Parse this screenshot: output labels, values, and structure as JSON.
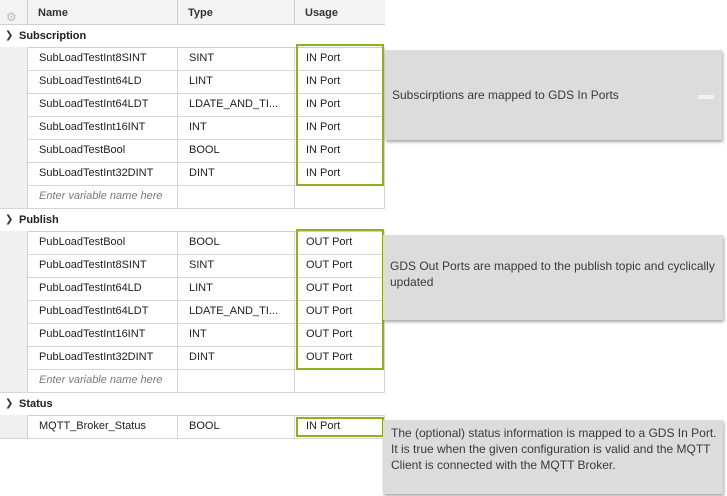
{
  "columns": {
    "name": "Name",
    "type": "Type",
    "usage": "Usage"
  },
  "groups": {
    "subscription": {
      "label": "Subscription",
      "rows": [
        {
          "name": "SubLoadTestInt8SINT",
          "type": "SINT",
          "usage": "IN Port"
        },
        {
          "name": "SubLoadTestInt64LD",
          "type": "LINT",
          "usage": "IN Port"
        },
        {
          "name": "SubLoadTestInt64LDT",
          "type": "LDATE_AND_TI...",
          "usage": "IN Port"
        },
        {
          "name": "SubLoadTestInt16INT",
          "type": "INT",
          "usage": "IN Port"
        },
        {
          "name": "SubLoadTestBool",
          "type": "BOOL",
          "usage": "IN Port"
        },
        {
          "name": "SubLoadTestInt32DINT",
          "type": "DINT",
          "usage": "IN Port"
        }
      ],
      "placeholder": "Enter variable name here"
    },
    "publish": {
      "label": "Publish",
      "rows": [
        {
          "name": "PubLoadTestBool",
          "type": "BOOL",
          "usage": "OUT Port"
        },
        {
          "name": "PubLoadTestInt8SINT",
          "type": "SINT",
          "usage": "OUT Port"
        },
        {
          "name": "PubLoadTestInt64LD",
          "type": "LINT",
          "usage": "OUT Port"
        },
        {
          "name": "PubLoadTestInt64LDT",
          "type": "LDATE_AND_TI...",
          "usage": "OUT Port"
        },
        {
          "name": "PubLoadTestInt16INT",
          "type": "INT",
          "usage": "OUT Port"
        },
        {
          "name": "PubLoadTestInt32DINT",
          "type": "DINT",
          "usage": "OUT Port"
        }
      ],
      "placeholder": "Enter variable name here"
    },
    "status": {
      "label": "Status",
      "rows": [
        {
          "name": "MQTT_Broker_Status",
          "type": "BOOL",
          "usage": "IN Port"
        }
      ]
    }
  },
  "notes": {
    "subscription": "Subscirptions are mapped to GDS In Ports",
    "publish": "GDS Out Ports are mapped to the publish topic and cyclically updated",
    "status": "The (optional) status information is mapped to a GDS In Port. It is true when the given configuration is valid and the MQTT Client is connected with the MQTT Broker."
  },
  "colors": {
    "highlight": "#8fb21c",
    "note_bg": "#dcdcdc"
  }
}
